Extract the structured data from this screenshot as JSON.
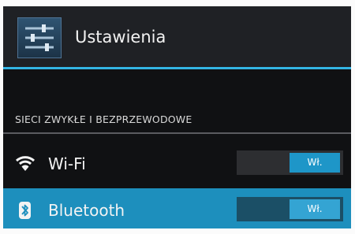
{
  "action_bar": {
    "title": "Ustawienia",
    "icon": "settings-sliders-icon"
  },
  "section": {
    "header": "SIECI ZWYKŁE I BEZPRZEWODOWE"
  },
  "items": [
    {
      "icon": "wifi-icon",
      "label": "Wi-Fi",
      "toggle_label": "Wł.",
      "enabled": true
    },
    {
      "icon": "bluetooth-icon",
      "label": "Bluetooth",
      "toggle_label": "Wł.",
      "enabled": true,
      "selected": true
    }
  ],
  "colors": {
    "accent": "#33b5e5",
    "selected_row": "#1d8fbd",
    "background": "#101113"
  }
}
